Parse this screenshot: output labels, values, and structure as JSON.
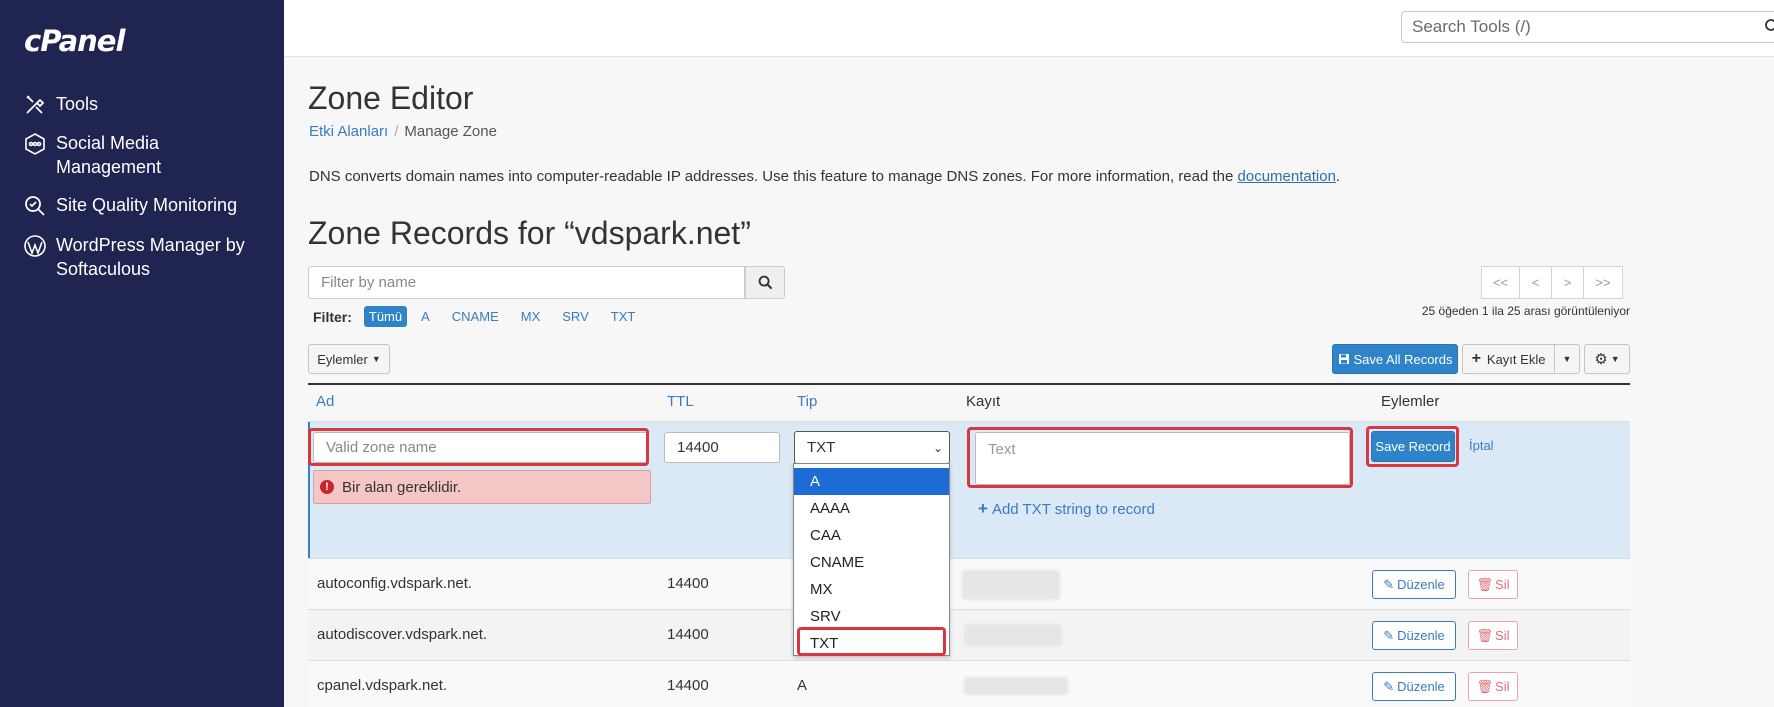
{
  "sidebar": {
    "logo": "cPanel",
    "items": [
      {
        "label": "Tools",
        "icon": "tools-icon"
      },
      {
        "label": "Social Media Management",
        "icon": "social-media-icon"
      },
      {
        "label": "Site Quality Monitoring",
        "icon": "site-quality-icon"
      },
      {
        "label": "WordPress Manager by Softaculous",
        "icon": "wordpress-icon"
      }
    ]
  },
  "header": {
    "search_placeholder": "Search Tools (/)"
  },
  "page": {
    "title": "Zone Editor",
    "breadcrumb": [
      "Etki Alanları",
      "Manage Zone"
    ],
    "description": "DNS converts domain names into computer-readable IP addresses. Use this feature to manage DNS zones. For more information, read the",
    "description_link": "documentation",
    "zone_title": "Zone Records for “vdspark.net”"
  },
  "filters": {
    "placeholder": "Filter by name",
    "label": "Filter:",
    "chips": [
      "Tümü",
      "A",
      "CNAME",
      "MX",
      "SRV",
      "TXT"
    ],
    "active": "Tümü"
  },
  "pagination": {
    "buttons": [
      "<<",
      "<",
      ">",
      ">>"
    ],
    "summary": "25 öğeden 1 ila 25 arası görüntüleniyor"
  },
  "toolbar": {
    "actions_label": "Eylemler",
    "save_all_label": "Save All Records",
    "add_record_label": "Kayıt Ekle"
  },
  "table": {
    "headers": [
      "Ad",
      "TTL",
      "Tip",
      "Kayıt",
      "Eylemler"
    ],
    "edit_row": {
      "name_placeholder": "Valid zone name",
      "ttl_value": "14400",
      "type_value": "TXT",
      "record_placeholder": "Text",
      "add_txt_label": "Add TXT string to record",
      "error_text": "Bir alan gereklidir.",
      "save_label": "Save Record",
      "cancel_label": "İptal"
    },
    "type_options": [
      "A",
      "AAAA",
      "CAA",
      "CNAME",
      "MX",
      "SRV",
      "TXT"
    ],
    "type_highlighted": "A",
    "rows": [
      {
        "name": "autoconfig.vdspark.net.",
        "ttl": "14400",
        "type": ""
      },
      {
        "name": "autodiscover.vdspark.net.",
        "ttl": "14400",
        "type": ""
      },
      {
        "name": "cpanel.vdspark.net.",
        "ttl": "14400",
        "type": "A"
      }
    ],
    "edit_label": "Düzenle",
    "delete_label": "Sil"
  },
  "colors": {
    "sidebar_bg": "#1f2451",
    "primary": "#2f84c9",
    "highlight_box": "#d9363e",
    "edit_row_bg": "#dbe9f6"
  }
}
